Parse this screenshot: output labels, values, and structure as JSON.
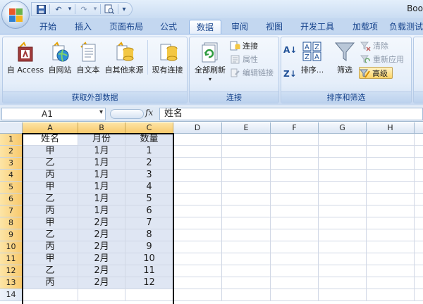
{
  "window": {
    "title": "Boo"
  },
  "quick_access": {
    "icons": [
      "save-icon",
      "undo-icon",
      "redo-icon",
      "print-preview-icon",
      "customize-icon"
    ],
    "symbols": {
      "undo": "↶",
      "redo": "↷",
      "dropdown": "▾",
      "customize": "▾"
    }
  },
  "tabs": [
    "开始",
    "插入",
    "页面布局",
    "公式",
    "数据",
    "审阅",
    "视图",
    "开发工具",
    "加载项",
    "负载测试"
  ],
  "active_tab": "数据",
  "ribbon": {
    "groups": [
      {
        "label": "获取外部数据",
        "buttons": [
          "自 Access",
          "自网站",
          "自文本",
          "自其他来源",
          "现有连接"
        ]
      },
      {
        "label": "连接",
        "big_button": "全部刷新",
        "small_buttons": [
          "连接",
          "属性",
          "编辑链接"
        ],
        "disabled": [
          "属性",
          "编辑链接"
        ]
      },
      {
        "label": "排序和筛选",
        "sort_buttons": [
          "升序",
          "降序"
        ],
        "sort_symbols": {
          "ascending": "A↓",
          "descending": "Z↓"
        },
        "big_buttons": [
          "排序...",
          "筛选"
        ],
        "small_buttons": [
          "清除",
          "重新应用",
          "高级"
        ],
        "disabled": [
          "清除",
          "重新应用"
        ],
        "highlighted": "高级"
      }
    ],
    "colors": {
      "accent_blue": "#15428b",
      "highlight": "#ffd466"
    }
  },
  "formula_bar": {
    "name_box": "A1",
    "fx_label": "fx",
    "formula": "姓名",
    "dropdown_symbol": "▾"
  },
  "sheet": {
    "columns": [
      "A",
      "B",
      "C",
      "D",
      "E",
      "F",
      "G",
      "H",
      ""
    ],
    "rows": [
      "1",
      "2",
      "3",
      "4",
      "5",
      "6",
      "7",
      "8",
      "9",
      "10",
      "11",
      "12",
      "13",
      "14"
    ],
    "cells": [
      [
        "姓名",
        "月份",
        "数量"
      ],
      [
        "甲",
        "1月",
        "1"
      ],
      [
        "乙",
        "1月",
        "2"
      ],
      [
        "丙",
        "1月",
        "3"
      ],
      [
        "甲",
        "1月",
        "4"
      ],
      [
        "乙",
        "1月",
        "5"
      ],
      [
        "丙",
        "1月",
        "6"
      ],
      [
        "甲",
        "2月",
        "7"
      ],
      [
        "乙",
        "2月",
        "8"
      ],
      [
        "丙",
        "2月",
        "9"
      ],
      [
        "甲",
        "2月",
        "10"
      ],
      [
        "乙",
        "2月",
        "11"
      ],
      [
        "丙",
        "2月",
        "12"
      ],
      [
        "",
        "",
        ""
      ]
    ],
    "selected_range": "A1:C13",
    "selection_color": "#dfe6f3"
  }
}
